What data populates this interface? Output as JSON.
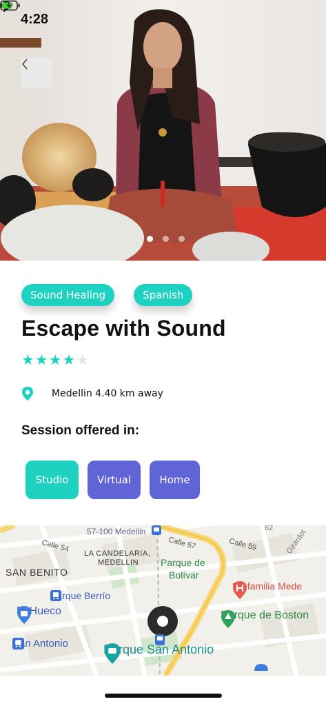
{
  "status_bar": {
    "time": "4:28"
  },
  "hero": {
    "dots": 3,
    "active_dot": 0
  },
  "tags": [
    "Sound Healing",
    "Spanish"
  ],
  "title": "Escape with Sound",
  "rating": {
    "value": 4,
    "max": 5,
    "filled_color": "#1fd1c1",
    "empty_color": "#e3e3e3"
  },
  "location": {
    "text": "Medellin 4.40 km away"
  },
  "session": {
    "label": "Session offered in:",
    "modes": [
      "Studio",
      "Virtual",
      "Home"
    ]
  },
  "map": {
    "labels": {
      "street_57_100": "57-100 Medellin",
      "calle_54": "Calle 54",
      "calle_57": "Calle 57",
      "calle_59": "Calle 59",
      "girardot": "Girardot",
      "num_62": "62",
      "la_candelaria": "LA CANDELARIA,",
      "medellin": "MEDELLIN",
      "san_benito": "SAN BENITO",
      "parque_bolivar_1": "Parque de",
      "parque_bolivar_2": "Bolívar",
      "profamilia": "Profamilia Mede",
      "parque_berrio": "Parque Berrío",
      "el_hueco": "El Hueco",
      "parque_boston": "Parque de Boston",
      "san_antonio": "San Antonio",
      "parque_san_antonio": "Parque San Antonio"
    }
  },
  "colors": {
    "teal": "#1fd1c1",
    "indigo": "#6164d6"
  }
}
